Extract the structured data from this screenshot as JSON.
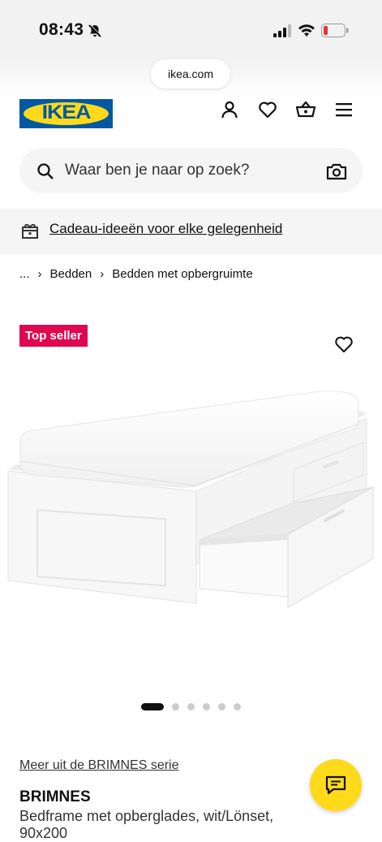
{
  "status": {
    "time": "08:43"
  },
  "browser": {
    "url": "ikea.com"
  },
  "header": {
    "logo_text": "IKEA",
    "icons": [
      "account-icon",
      "heart-icon",
      "basket-icon",
      "menu-icon"
    ]
  },
  "search": {
    "placeholder": "Waar ben je naar op zoek?"
  },
  "promo": {
    "label": "Cadeau-ideeën voor elke gelegenheid"
  },
  "breadcrumb": {
    "items": [
      "...",
      "Bedden",
      "Bedden met opbergruimte"
    ]
  },
  "product": {
    "badge": "Top seller",
    "series_link": "Meer uit de BRIMNES serie",
    "name": "BRIMNES",
    "description": "Bedframe met opberglades, wit/Lönset,",
    "description_cont": "90x200",
    "gallery": {
      "count": 6,
      "active": 1
    }
  },
  "colors": {
    "ikea_blue": "#0058a3",
    "ikea_yellow": "#ffda1a",
    "badge_red": "#e00751"
  }
}
